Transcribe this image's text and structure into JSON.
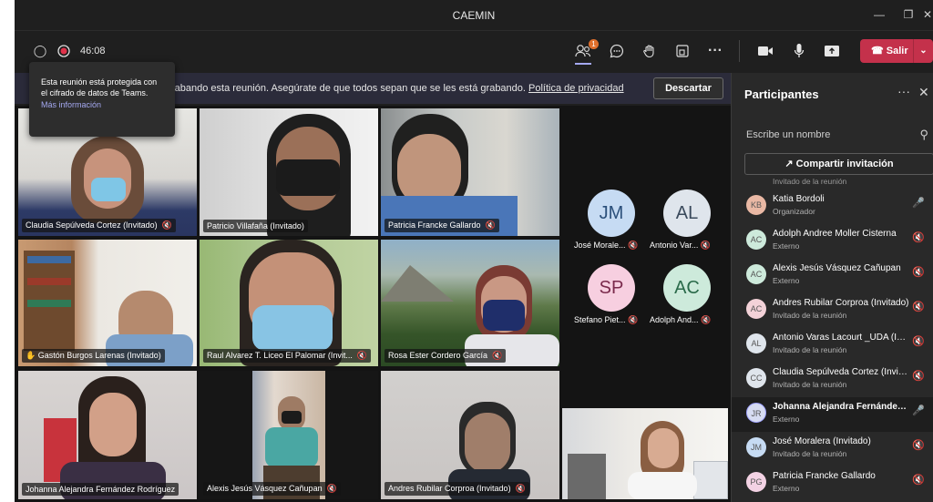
{
  "window": {
    "title": "CAEMIN"
  },
  "toolbar": {
    "timer": "46:08",
    "leave_label": "Salir",
    "participants_badge": "1"
  },
  "banner": {
    "text": "rabando esta reunión. Asegúrate de que todos sepan que se les está grabando.",
    "link": "Política de privacidad",
    "dismiss_label": "Descartar"
  },
  "tooltip": {
    "text": "Esta reunión está protegida con el cifrado de datos de Teams.",
    "more": "Más información"
  },
  "videos": [
    {
      "name": "Claudia Sepúlveda Cortez (Invitado)"
    },
    {
      "name": "Patricio Villafaña (Invitado)"
    },
    {
      "name": "Patricia Francke Gallardo"
    },
    {
      "name": "Gastón Burgos Larenas (Invitado)"
    },
    {
      "name": "Raul Alvarez T. Liceo El Palomar (Invit..."
    },
    {
      "name": "Rosa Ester Cordero García"
    },
    {
      "name": "Johanna Alejandra Fernández Rodríguez"
    },
    {
      "name": "Alexis Jesús Vásquez Cañupan"
    },
    {
      "name": "Andres Rubilar Corproa (Invitado)"
    }
  ],
  "avatars": [
    {
      "initials": "JM",
      "name": "José Morale...",
      "color": "#c6dbf3",
      "text": "#2b4f7a"
    },
    {
      "initials": "AL",
      "name": "Antonio Var...",
      "color": "#dfe5ec",
      "text": "#3a4a5c"
    },
    {
      "initials": "SP",
      "name": "Stefano Piet...",
      "color": "#f7cfe0",
      "text": "#7a2a4c"
    },
    {
      "initials": "AC",
      "name": "Adolph And...",
      "color": "#cdeadb",
      "text": "#2a6a4a"
    }
  ],
  "panel": {
    "title": "Participantes",
    "search_placeholder": "Escribe un nombre",
    "invite_label": "Compartir invitación",
    "cut_text": "Invitado de la reunión",
    "people": [
      {
        "initials": "KB",
        "name": "Katia Bordoli",
        "role": "Organizador",
        "color": "#e9b8a4",
        "active": false
      },
      {
        "initials": "AC",
        "name": "Adolph Andree Moller Cisterna",
        "role": "Externo",
        "color": "#cdeadb",
        "active": false
      },
      {
        "initials": "AC",
        "name": "Alexis Jesús Vásquez Cañupan",
        "role": "Externo",
        "color": "#cdeadb",
        "active": false
      },
      {
        "initials": "AC",
        "name": "Andres Rubilar Corproa (Invitado)",
        "role": "Invitado de la reunión",
        "color": "#f3d2d8",
        "active": false
      },
      {
        "initials": "AL",
        "name": "Antonio Varas Lacourt _UDA (Invitado)",
        "role": "Invitado de la reunión",
        "color": "#dfe5ec",
        "active": false
      },
      {
        "initials": "CC",
        "name": "Claudia Sepúlveda Cortez (Invitado)",
        "role": "Invitado de la reunión",
        "color": "#dfe5ec",
        "active": false
      },
      {
        "initials": "JR",
        "name": "Johanna Alejandra Fernández Rodríguez",
        "role": "Externo",
        "color": "#d7dcf2",
        "active": true
      },
      {
        "initials": "JM",
        "name": "José Moralera (Invitado)",
        "role": "Invitado de la reunión",
        "color": "#c6dbf3",
        "active": false
      },
      {
        "initials": "PG",
        "name": "Patricia Francke Gallardo",
        "role": "Externo",
        "color": "#f3d2e4",
        "active": false
      }
    ]
  }
}
